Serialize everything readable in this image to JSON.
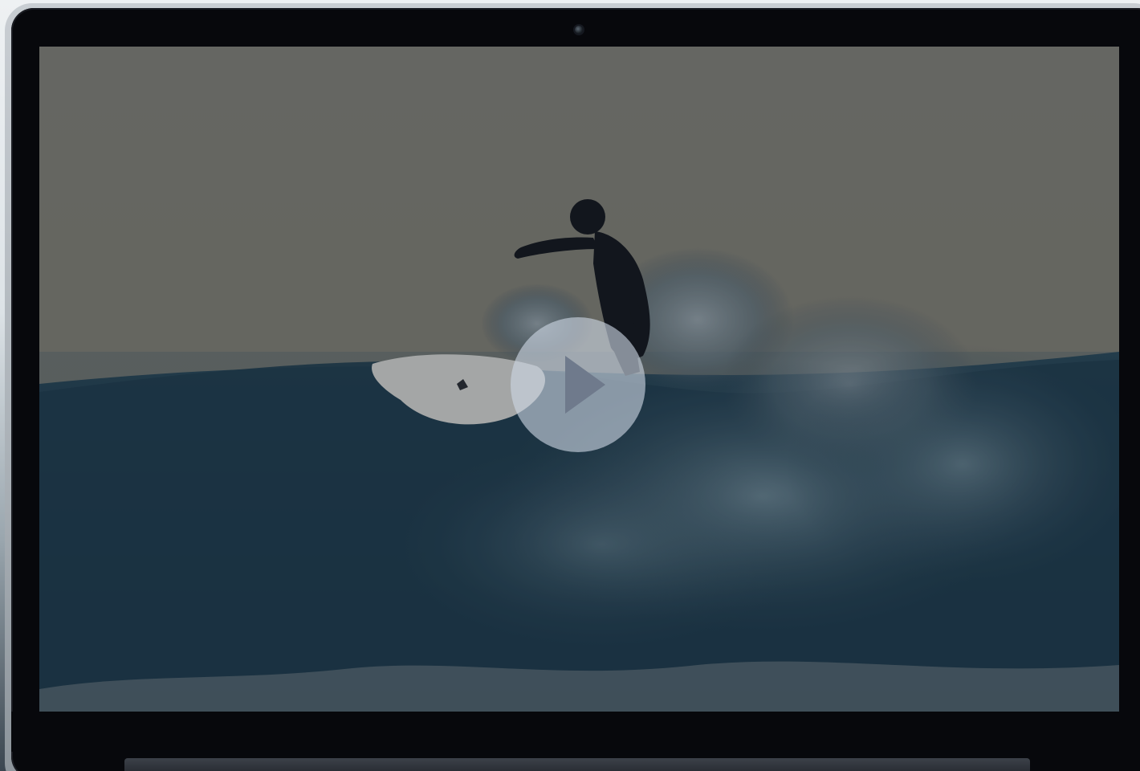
{
  "device": {
    "type": "laptop",
    "camera_icon": "webcam-icon"
  },
  "video": {
    "scene": "surfer-on-wave",
    "state": "paused",
    "play_icon": "play-icon",
    "colors": {
      "sky": "#7b7c73",
      "water": "#1f3a4a",
      "overlay_button": "#cdd6e4"
    }
  }
}
